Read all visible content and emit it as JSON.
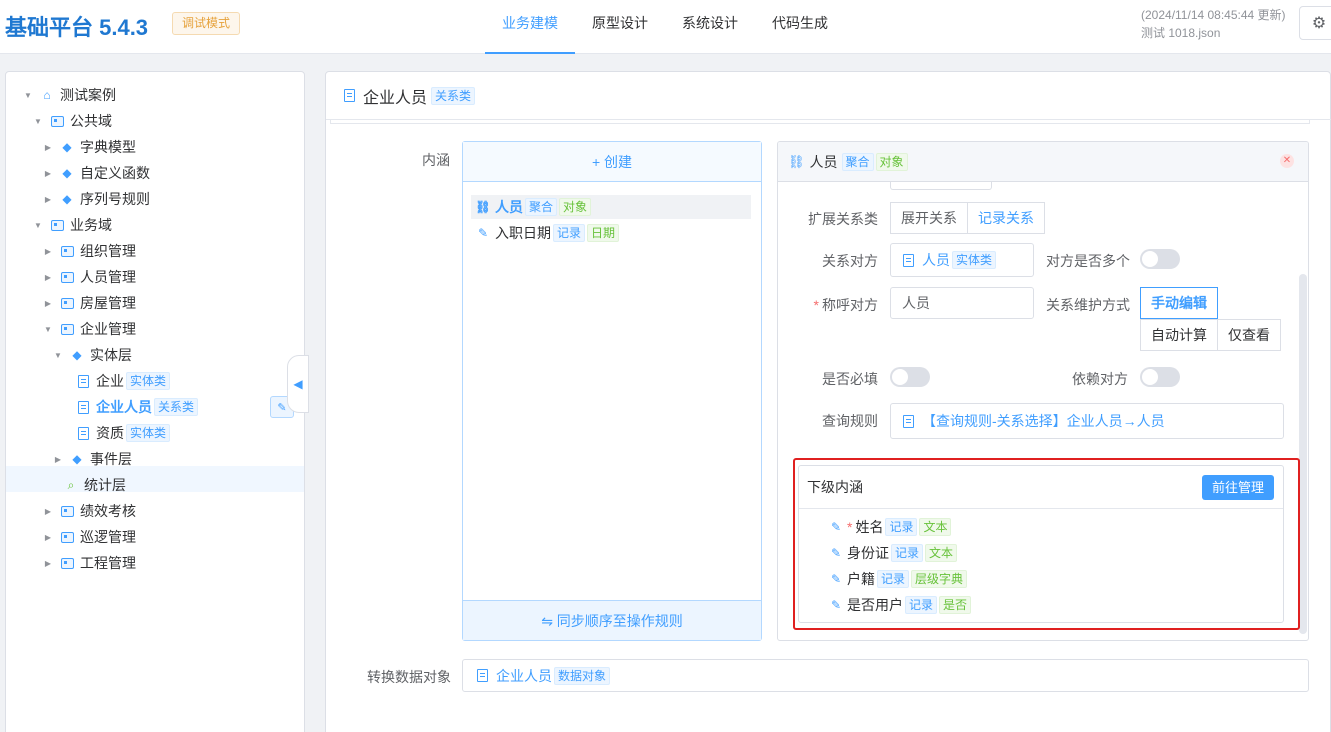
{
  "header": {
    "app_title": "基础平台 5.4.3",
    "mode_badge": "调试模式",
    "nav": [
      "业务建模",
      "原型设计",
      "系统设计",
      "代码生成"
    ],
    "active_nav": "业务建模",
    "update_time": "(2024/11/14 08:45:44 更新)",
    "file_name": "测试 1018.json",
    "settings_icon": "gear-icon"
  },
  "tree": {
    "root": "测试案例",
    "public_domain": "公共域",
    "public_children": [
      "字典模型",
      "自定义函数",
      "序列号规则"
    ],
    "business_domain": "业务域",
    "biz_modules": [
      "组织管理",
      "人员管理",
      "房屋管理",
      "企业管理"
    ],
    "entity_layer": "实体层",
    "entity_items": [
      {
        "label": "企业",
        "tag": "实体类"
      },
      {
        "label": "企业人员",
        "tag": "关系类"
      },
      {
        "label": "资质",
        "tag": "实体类"
      }
    ],
    "event_layer": "事件层",
    "stat_layer": "统计层",
    "more_modules": [
      "绩效考核",
      "巡逻管理",
      "工程管理"
    ]
  },
  "main": {
    "title": "企业人员",
    "title_tag": "关系类",
    "connotation_label": "内涵",
    "create_label": "+ 创建",
    "connotation_items": [
      {
        "label": "人员",
        "tags": [
          "聚合",
          "对象"
        ]
      },
      {
        "label": "入职日期",
        "tags": [
          "记录",
          "日期"
        ]
      }
    ],
    "sync_label": "⇋ 同步顺序至操作规则",
    "convert_label": "转换数据对象",
    "convert_value": "企业人员",
    "convert_tag": "数据对象"
  },
  "detail": {
    "title": "人员",
    "tags": [
      "聚合",
      "对象"
    ],
    "ext_relation_label": "扩展关系类",
    "ext_relation_options": [
      "展开关系",
      "记录关系"
    ],
    "rel_peer_label": "关系对方",
    "rel_peer_value": "人员",
    "rel_peer_tag": "实体类",
    "peer_multi_label": "对方是否多个",
    "call_peer_label": "称呼对方",
    "call_peer_value": "人员",
    "maintain_label": "关系维护方式",
    "maintain_options": [
      "手动编辑",
      "自动计算",
      "仅查看"
    ],
    "required_label": "是否必填",
    "depend_label": "依赖对方",
    "query_rule_label": "查询规则",
    "query_rule_value": "【查询规则-关系选择】企业人员→人员"
  },
  "sub_connotation": {
    "title": "下级内涵",
    "manage_button": "前往管理",
    "items": [
      {
        "label": "姓名",
        "required": "*",
        "tags": [
          "记录",
          "文本"
        ]
      },
      {
        "label": "身份证",
        "required": "",
        "tags": [
          "记录",
          "文本"
        ]
      },
      {
        "label": "户籍",
        "required": "",
        "tags": [
          "记录",
          "层级字典"
        ]
      },
      {
        "label": "是否用户",
        "required": "",
        "tags": [
          "记录",
          "是否"
        ]
      }
    ]
  },
  "colors": {
    "primary": "#409eff",
    "title_blue": "#1f78d1",
    "highlight_red": "#e02020",
    "warning": "#e6a23c",
    "success": "#67c23a"
  }
}
